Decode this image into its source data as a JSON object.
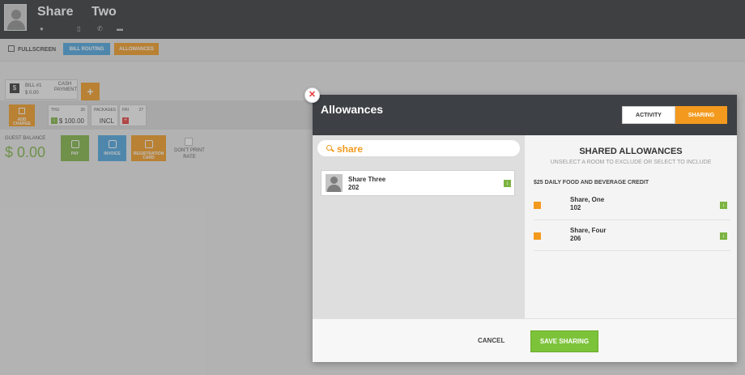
{
  "header": {
    "guest_first": "Share",
    "guest_last": "Two",
    "icons": [
      "location-pin-icon",
      "mobile-phone-icon",
      "phone-icon",
      "email-icon"
    ]
  },
  "toolbar": {
    "fullscreen_label": "FULLSCREEN",
    "bill_routing_label": "BILL ROUTING",
    "allowances_label": "ALLOWANCES"
  },
  "folio": {
    "bill_label": "BILL #1",
    "bill_amount": "$ 0.00",
    "bill_payment": "CASH PAYMENT",
    "add_bill_label": "+",
    "add_charge_label": "ADD CHARGE",
    "days": [
      {
        "label": "THU",
        "num": "26",
        "value": "$ 100.00"
      },
      {
        "label": "PACKAGES",
        "num": "",
        "value": "INCL"
      },
      {
        "label": "FRI",
        "num": "27",
        "value": ""
      }
    ],
    "guest_balance_label": "GUEST BALANCE",
    "guest_balance": "$ 0.00",
    "pay_label": "PAY",
    "invoice_label": "INVOICE",
    "registration_label": "REGISTRATION CARD",
    "dont_print_label": "DON'T PRINT RATE"
  },
  "modal": {
    "title": "Allowances",
    "tab_activity": "ACTIVITY",
    "tab_sharing": "SHARING",
    "search_value": "share",
    "results": [
      {
        "name": "Share Three",
        "room": "202"
      }
    ],
    "shared_title": "SHARED ALLOWANCES",
    "shared_subtitle": "UNSELECT A ROOM TO EXCLUDE OR SELECT TO INCLUDE",
    "allowance_name": "$25 DAILY FOOD AND BEVERAGE CREDIT",
    "shared": [
      {
        "name": "Share, One",
        "room": "102"
      },
      {
        "name": "Share, Four",
        "room": "206"
      }
    ],
    "cancel_label": "CANCEL",
    "save_label": "SAVE SHARING"
  },
  "colors": {
    "accent_orange": "#f39a1e",
    "accent_green": "#7cc33a",
    "accent_blue": "#4aa3df",
    "header_dark": "#2e3135"
  }
}
